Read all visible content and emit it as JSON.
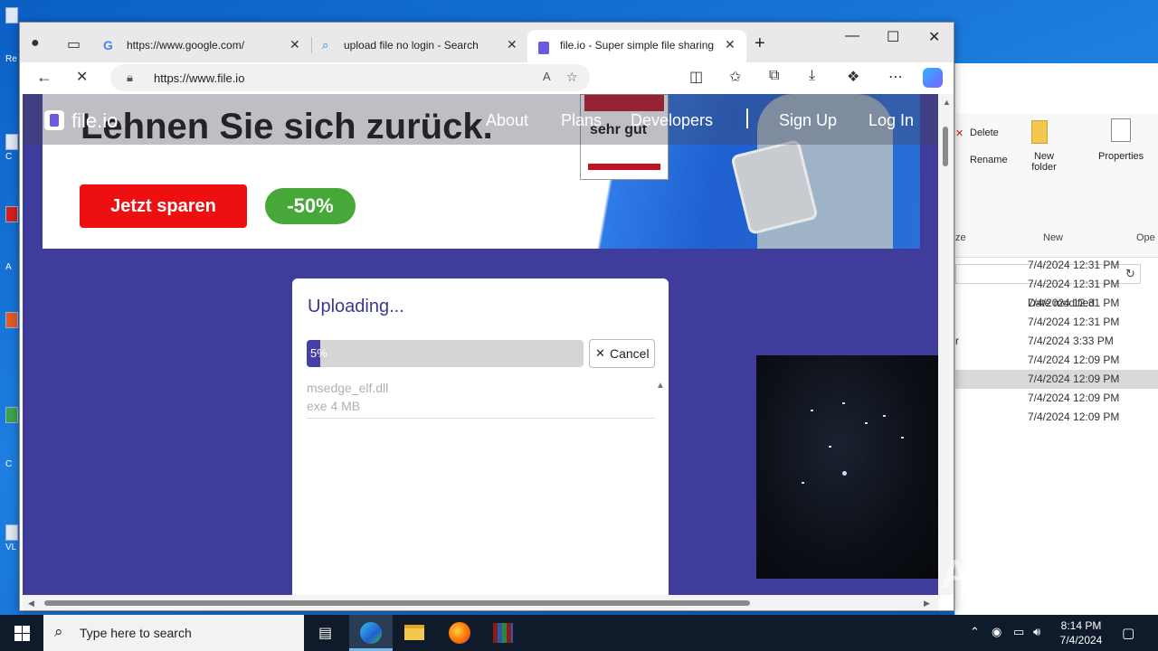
{
  "desktop": {
    "labels": [
      "Re",
      "C",
      "A",
      "C",
      "VL"
    ]
  },
  "explorer": {
    "ribbon": {
      "delete": "Delete",
      "rename": "Rename",
      "new_folder": "New folder",
      "properties": "Properties",
      "group_new": "New",
      "group_open": "Ope",
      "group_organize": "ze"
    },
    "column_header": "Date modified",
    "rows": [
      {
        "date": "7/4/2024 12:31 PM",
        "prefix": ""
      },
      {
        "date": "7/4/2024 12:31 PM",
        "prefix": ""
      },
      {
        "date": "7/4/2024 12:31 PM",
        "prefix": ""
      },
      {
        "date": "7/4/2024 12:31 PM",
        "prefix": ""
      },
      {
        "date": "7/4/2024 3:33 PM",
        "prefix": "r"
      },
      {
        "date": "7/4/2024 12:09 PM",
        "prefix": ""
      },
      {
        "date": "7/4/2024 12:09 PM",
        "prefix": "",
        "selected": true
      },
      {
        "date": "7/4/2024 12:09 PM",
        "prefix": ""
      },
      {
        "date": "7/4/2024 12:09 PM",
        "prefix": ""
      }
    ]
  },
  "browser": {
    "tabs": [
      {
        "title": "https://www.google.com/",
        "icon": "google-icon"
      },
      {
        "title": "upload file no login - Search",
        "icon": "search-icon"
      },
      {
        "title": "file.io - Super simple file sharing",
        "icon": "fileio-icon",
        "active": true
      }
    ],
    "new_tab": "+",
    "url": "https://www.file.io"
  },
  "page": {
    "nav": {
      "logo": "file.io",
      "links": [
        "About",
        "Plans",
        "Developers",
        "Sign Up",
        "Log In"
      ]
    },
    "ad": {
      "headline": "Lehnen Sie sich zurück.",
      "cta": "Jetzt sparen",
      "discount": "-50%",
      "badge": "sehr gut"
    },
    "upload": {
      "title": "Uploading...",
      "progress_percent": 5,
      "progress_label": "5%",
      "cancel": "Cancel",
      "file_name": "msedge_elf.dll",
      "file_size": "exe 4 MB"
    }
  },
  "watermark": "ANY RUN",
  "taskbar": {
    "search_placeholder": "Type here to search",
    "time": "8:14 PM",
    "date": "7/4/2024"
  }
}
